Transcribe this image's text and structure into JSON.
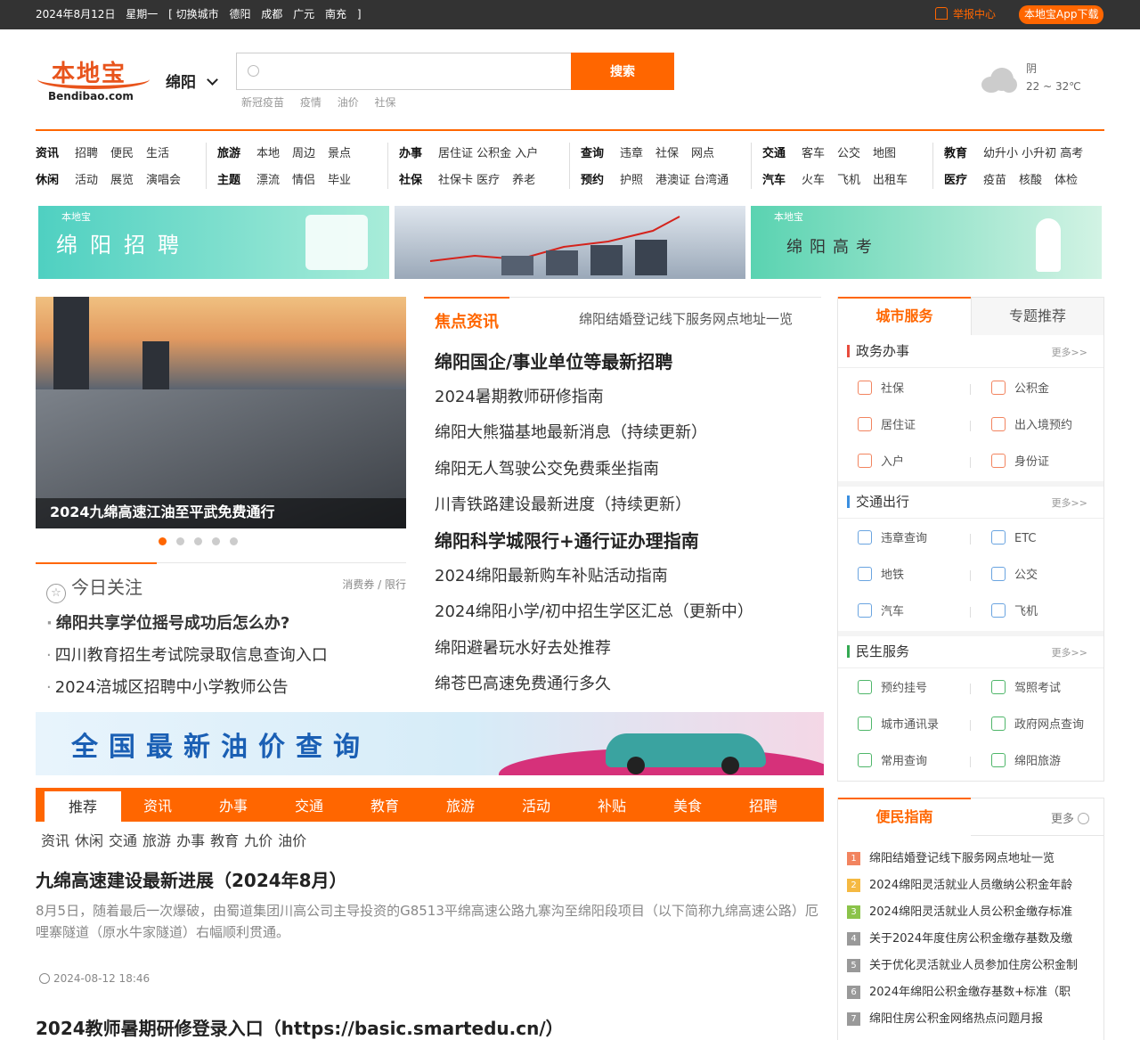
{
  "topbar": {
    "date": "2024年8月12日",
    "weekday": "星期一",
    "switch_label": "[ 切换城市",
    "cities": [
      "德阳",
      "成都",
      "广元",
      "南充"
    ],
    "close_bracket": "]",
    "report": "举报中心",
    "app_download": "本地宝App下载"
  },
  "header": {
    "logo_cn": "本地宝",
    "logo_en": "Bendibao.com",
    "city": "绵阳",
    "search_placeholder": "",
    "search_button": "搜索",
    "hotwords": [
      "新冠疫苗",
      "疫情",
      "油价",
      "社保"
    ],
    "weather_condition": "阴",
    "weather_temp": "22 ~ 32℃"
  },
  "nav": [
    {
      "rows": [
        [
          "资讯",
          "招聘",
          "便民",
          "生活"
        ],
        [
          "休闲",
          "活动",
          "展览",
          "演唱会"
        ]
      ]
    },
    {
      "rows": [
        [
          "旅游",
          "本地",
          "周边",
          "景点"
        ],
        [
          "主题",
          "漂流",
          "情侣",
          "毕业"
        ]
      ]
    },
    {
      "rows": [
        [
          "办事",
          "居住证 公积金 入户"
        ],
        [
          "社保",
          "社保卡 医疗",
          "养老"
        ]
      ]
    },
    {
      "rows": [
        [
          "查询",
          "违章",
          "社保",
          "网点"
        ],
        [
          "预约",
          "护照",
          "港澳证 台湾通"
        ]
      ]
    },
    {
      "rows": [
        [
          "交通",
          "客车",
          "公交",
          "地图"
        ],
        [
          "汽车",
          "火车",
          "飞机",
          "出租车"
        ]
      ]
    },
    {
      "rows": [
        [
          "教育",
          "幼升小 小升初 高考"
        ],
        [
          "医疗",
          "疫苗",
          "核酸",
          "体检"
        ]
      ]
    }
  ],
  "banners": {
    "b1_logo": "本地宝",
    "b1_title": "绵阳招聘",
    "b3_logo": "本地宝",
    "b3_title": "绵阳高考"
  },
  "slider": {
    "caption": "2024九绵高速江油至平武免费通行",
    "active_index": 1,
    "dots": 5
  },
  "focus": {
    "title": "今日关注",
    "more": "消费券 / 限行",
    "items": [
      {
        "text": "绵阳共享学位摇号成功后怎么办?",
        "bold": true
      },
      {
        "text": "四川教育招生考试院录取信息查询入口",
        "bold": false
      },
      {
        "text": "2024涪城区招聘中小学教师公告",
        "bold": false
      }
    ]
  },
  "news": {
    "title": "焦点资讯",
    "subtitle": "绵阳结婚登记线下服务网点地址一览",
    "items": [
      {
        "text": "绵阳国企/事业单位等最新招聘",
        "bold": true
      },
      {
        "text": "2024暑期教师研修指南",
        "bold": false
      },
      {
        "text": "绵阳大熊猫基地最新消息（持续更新）",
        "bold": false
      },
      {
        "text": "绵阳无人驾驶公交免费乘坐指南",
        "bold": false
      },
      {
        "text": "川青铁路建设最新进度（持续更新）",
        "bold": false
      },
      {
        "text": "绵阳科学城限行+通行证办理指南",
        "bold": true
      },
      {
        "text": "2024绵阳最新购车补贴活动指南",
        "bold": false
      },
      {
        "text": "2024绵阳小学/初中招生学区汇总（更新中）",
        "bold": false
      },
      {
        "text": "绵阳避暑玩水好去处推荐",
        "bold": false
      },
      {
        "text": "绵苍巴高速免费通行多久",
        "bold": false
      }
    ]
  },
  "oil_banner": {
    "text": "全国最新油价查询"
  },
  "tabs": {
    "items": [
      "推荐",
      "资讯",
      "办事",
      "交通",
      "教育",
      "旅游",
      "活动",
      "补贴",
      "美食",
      "招聘"
    ],
    "active": 0,
    "subtabs": [
      "资讯",
      "休闲",
      "交通",
      "旅游",
      "办事",
      "教育",
      "九价",
      "油价"
    ]
  },
  "article": {
    "title": "九绵高速建设最新进展（2024年8月）",
    "desc": "8月5日，随着最后一次爆破，由蜀道集团川高公司主导投资的G8513平绵高速公路九寨沟至绵阳段项目（以下简称九绵高速公路）厄哩寨隧道（原水牛家隧道）右幅顺利贯通。",
    "time": "2024-08-12 18:46",
    "next_title": "2024教师暑期研修登录入口（https://basic.smartedu.cn/）"
  },
  "sidebar": {
    "tab_active": "城市服务",
    "tab_other": "专题推荐",
    "sections": [
      {
        "name": "政务办事",
        "more": "更多>>",
        "color": "#e84c3d",
        "items": [
          [
            "社保",
            "公积金"
          ],
          [
            "居住证",
            "出入境预约"
          ],
          [
            "入户",
            "身份证"
          ]
        ]
      },
      {
        "name": "交通出行",
        "more": "更多>>",
        "color": "#3b8fe0",
        "items": [
          [
            "违章查询",
            "ETC"
          ],
          [
            "地铁",
            "公交"
          ],
          [
            "汽车",
            "飞机"
          ]
        ]
      },
      {
        "name": "民生服务",
        "more": "更多>>",
        "color": "#35a952",
        "items": [
          [
            "预约挂号",
            "驾照考试"
          ],
          [
            "城市通讯录",
            "政府网点查询"
          ],
          [
            "常用查询",
            "绵阳旅游"
          ]
        ]
      }
    ]
  },
  "guide": {
    "title": "便民指南",
    "more": "更多",
    "items": [
      {
        "n": "1",
        "text": "绵阳结婚登记线下服务网点地址一览",
        "color": "#f2845f"
      },
      {
        "n": "2",
        "text": "2024绵阳灵活就业人员缴纳公积金年龄",
        "color": "#f5b942"
      },
      {
        "n": "3",
        "text": "2024绵阳灵活就业人员公积金缴存标准",
        "color": "#8bc34a"
      },
      {
        "n": "4",
        "text": "关于2024年度住房公积金缴存基数及缴",
        "color": "#999999"
      },
      {
        "n": "5",
        "text": "关于优化灵活就业人员参加住房公积金制",
        "color": "#999999"
      },
      {
        "n": "6",
        "text": "2024年绵阳公积金缴存基数+标准（职",
        "color": "#999999"
      },
      {
        "n": "7",
        "text": "绵阳住房公积金网络热点问题月报",
        "color": "#999999"
      }
    ]
  }
}
